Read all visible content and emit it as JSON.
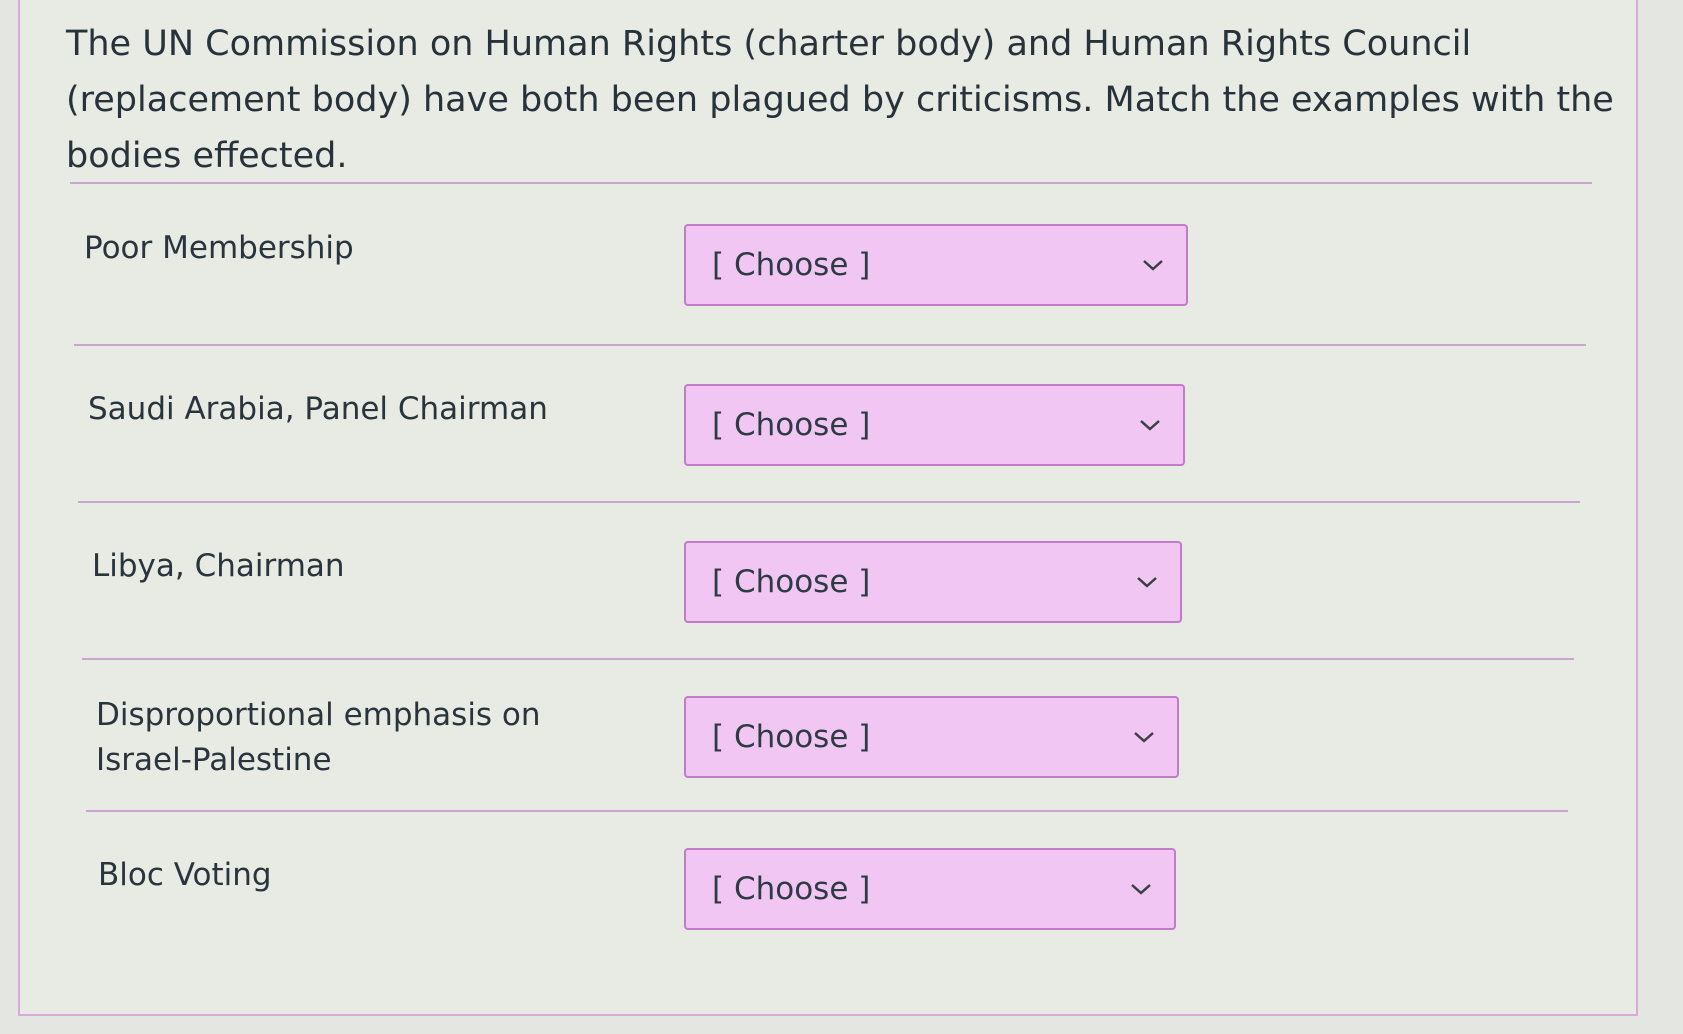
{
  "question": {
    "text": "The UN Commission on Human Rights (charter body) and Human Rights Council (replacement body) have both been plagued by criticisms. Match the examples with the bodies effected."
  },
  "matches": [
    {
      "label": "Poor Membership",
      "selected": "[ Choose ]"
    },
    {
      "label": "Saudi Arabia, Panel Chairman",
      "selected": "[ Choose ]"
    },
    {
      "label": "Libya, Chairman",
      "selected": "[ Choose ]"
    },
    {
      "label": "Disproportional emphasis on Israel-Palestine",
      "selected": "[ Choose ]"
    },
    {
      "label": "Bloc Voting",
      "selected": "[ Choose ]"
    }
  ],
  "colors": {
    "accent_border": "#c07cc8",
    "select_background": "#f2c6f2",
    "divider": "#c9a6cf"
  },
  "icons": {
    "dropdown": "chevron-down-icon"
  }
}
